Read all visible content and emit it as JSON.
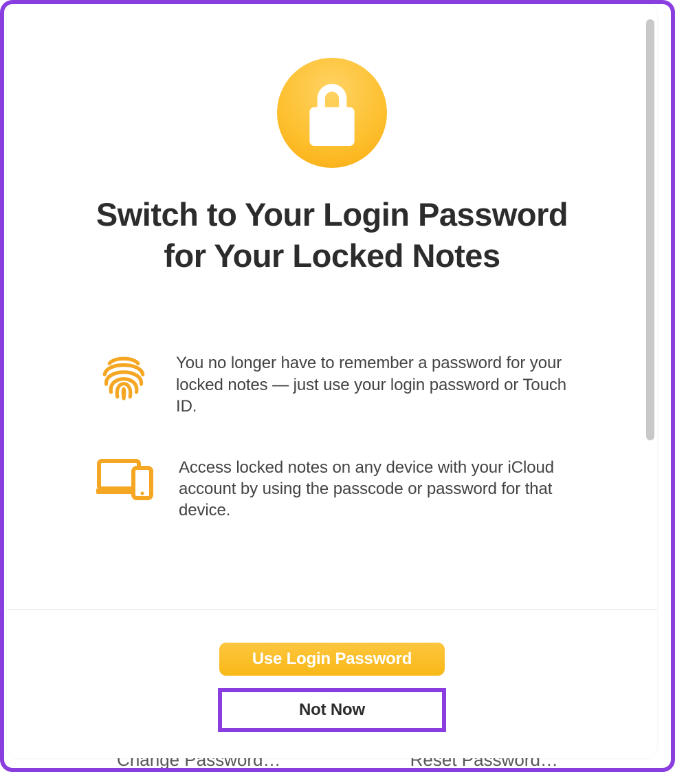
{
  "colors": {
    "highlight": "#8a3ee0",
    "accent_gradient_top": "#fed364",
    "accent_gradient_bottom": "#f9a90c",
    "icon_accent": "#f5a623"
  },
  "background": {
    "change_password_label": "Change Password…",
    "reset_password_label": "Reset Password…"
  },
  "modal": {
    "headline": "Switch to Your Login Password for Your Locked Notes",
    "bullets": [
      {
        "icon": "fingerprint-icon",
        "text": "You no longer have to remember a password for your locked notes — just use your login password or Touch ID."
      },
      {
        "icon": "devices-icon",
        "text": "Access locked notes on any device with your iCloud account by using the passcode or password for that device."
      }
    ],
    "primary_button": "Use Login Password",
    "secondary_button": "Not Now"
  }
}
